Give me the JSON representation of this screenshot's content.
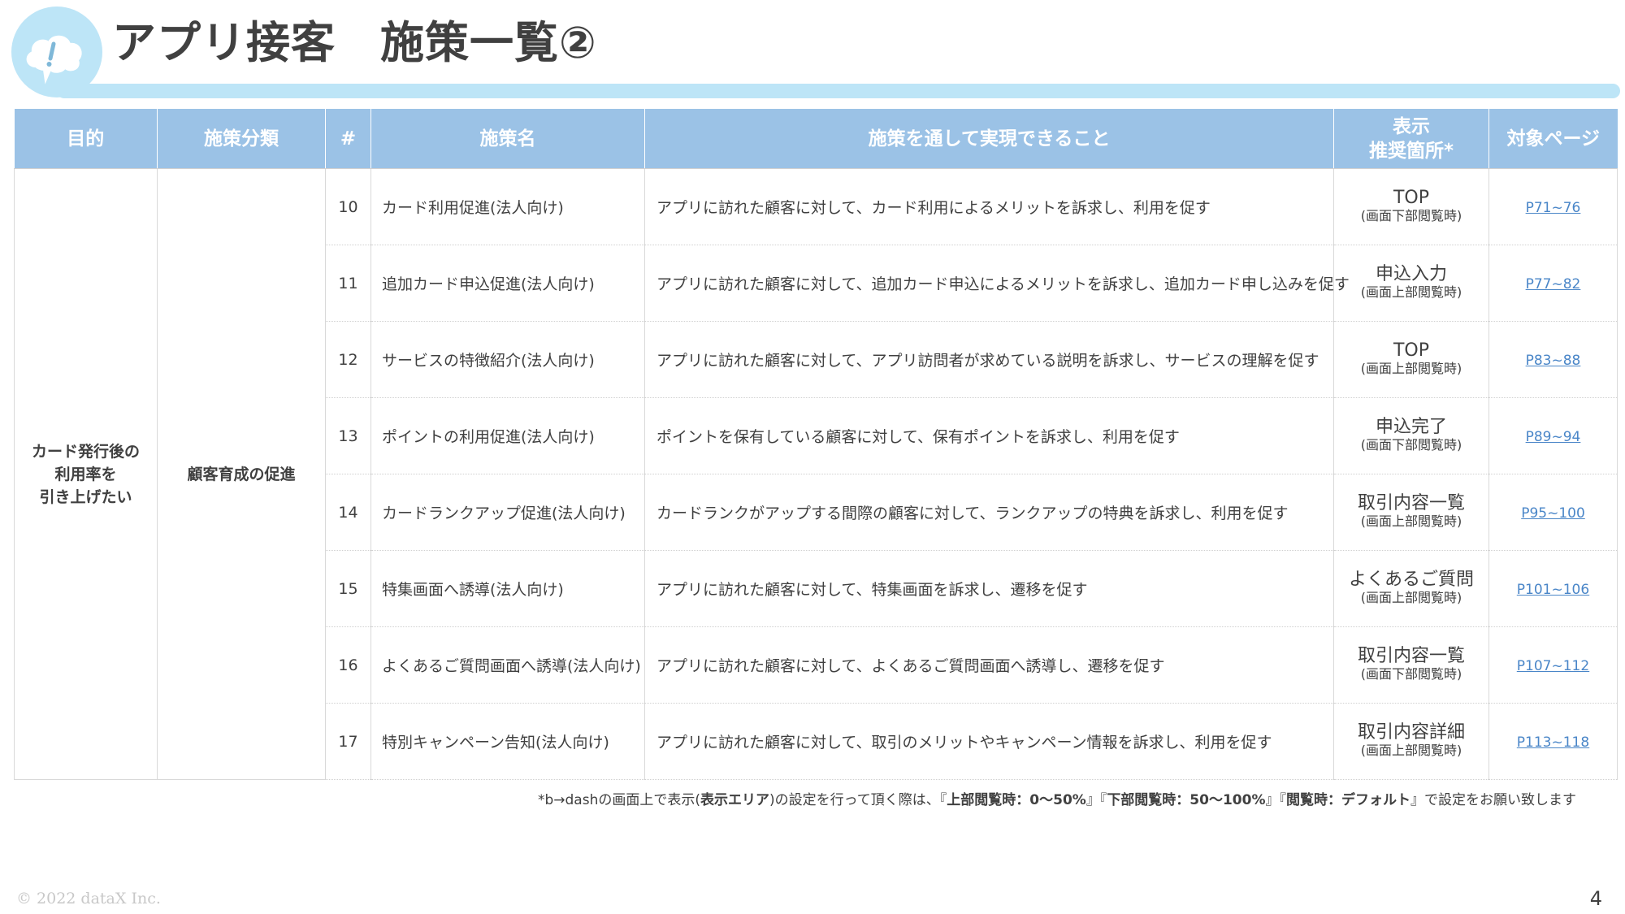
{
  "title": "アプリ接客　施策一覧②",
  "table": {
    "headers": {
      "purpose": "目的",
      "category": "施策分類",
      "number": "#",
      "name": "施策名",
      "achieve": "施策を通して実現できること",
      "display_line1": "表示",
      "display_line2": "推奨箇所*",
      "target_page": "対象ページ"
    },
    "purpose": {
      "line1": "カード発行後の",
      "line2": "利用率を",
      "line3": "引き上げたい"
    },
    "category": "顧客育成の促進",
    "rows": [
      {
        "num": "10",
        "name": "カード利用促進(法人向け)",
        "desc": "アプリに訪れた顧客に対して、カード利用によるメリットを訴求し、利用を促す",
        "loc_main": "TOP",
        "loc_sub": "(画面下部閲覧時)",
        "page": "P71~76"
      },
      {
        "num": "11",
        "name": "追加カード申込促進(法人向け)",
        "desc": "アプリに訪れた顧客に対して、追加カード申込によるメリットを訴求し、追加カード申し込みを促す",
        "loc_main": "申込入力",
        "loc_sub": "(画面上部閲覧時)",
        "page": "P77~82"
      },
      {
        "num": "12",
        "name": "サービスの特徴紹介(法人向け)",
        "desc": "アプリに訪れた顧客に対して、アプリ訪問者が求めている説明を訴求し、サービスの理解を促す",
        "loc_main": "TOP",
        "loc_sub": "(画面上部閲覧時)",
        "page": "P83~88"
      },
      {
        "num": "13",
        "name": "ポイントの利用促進(法人向け)",
        "desc": "ポイントを保有している顧客に対して、保有ポイントを訴求し、利用を促す",
        "loc_main": "申込完了",
        "loc_sub": "(画面下部閲覧時)",
        "page": "P89~94"
      },
      {
        "num": "14",
        "name": "カードランクアップ促進(法人向け)",
        "desc": "カードランクがアップする間際の顧客に対して、ランクアップの特典を訴求し、利用を促す",
        "loc_main": "取引内容一覧",
        "loc_sub": "(画面上部閲覧時)",
        "page": "P95~100"
      },
      {
        "num": "15",
        "name": "特集画面へ誘導(法人向け)",
        "desc": "アプリに訪れた顧客に対して、特集画面を訴求し、遷移を促す",
        "loc_main": "よくあるご質問",
        "loc_sub": "(画面上部閲覧時)",
        "page": "P101~106"
      },
      {
        "num": "16",
        "name": "よくあるご質問画面へ誘導(法人向け)",
        "desc": "アプリに訪れた顧客に対して、よくあるご質問画面へ誘導し、遷移を促す",
        "loc_main": "取引内容一覧",
        "loc_sub": "(画面下部閲覧時)",
        "page": "P107~112"
      },
      {
        "num": "17",
        "name": "特別キャンペーン告知(法人向け)",
        "desc": "アプリに訪れた顧客に対して、取引のメリットやキャンペーン情報を訴求し、利用を促す",
        "loc_main": "取引内容詳細",
        "loc_sub": "(画面上部閲覧時)",
        "page": "P113~118"
      }
    ]
  },
  "footnote": {
    "part1": "*b→dashの画面上で表示(",
    "bold1": "表示エリア",
    "part2": ")の設定を行って頂く際は、『",
    "bold2": "上部閲覧時：0〜50%",
    "part3": "』『",
    "bold3": "下部閲覧時：50〜100%",
    "part4": "』『",
    "bold4": "閲覧時：デフォルト",
    "part5": "』で設定をお願い致します"
  },
  "copyright": "© 2022 dataX Inc.",
  "page_number": "4",
  "colors": {
    "header_accent": "#bde5f7",
    "table_header": "#9bc2e6",
    "link": "#4a86c8"
  },
  "icons": {
    "header": "cloud-exclamation-icon"
  }
}
